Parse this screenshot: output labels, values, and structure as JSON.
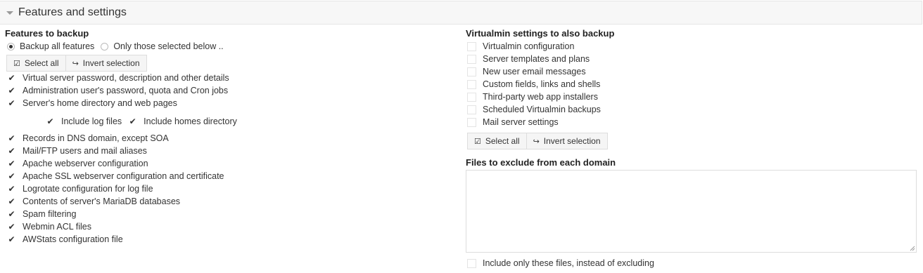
{
  "header": {
    "title": "Features and settings"
  },
  "features": {
    "title": "Features to backup",
    "radio_all": "Backup all features",
    "radio_selected": "Only those selected below ..",
    "select_all": "Select all",
    "invert_selection": "Invert selection",
    "items_top": [
      "Virtual server password, description and other details",
      "Administration user's password, quota and Cron jobs",
      "Server's home directory and web pages"
    ],
    "include_log": "Include log files",
    "include_homes": "Include homes directory",
    "items_bottom": [
      "Records in DNS domain, except SOA",
      "Mail/FTP users and mail aliases",
      "Apache webserver configuration",
      "Apache SSL webserver configuration and certificate",
      "Logrotate configuration for log file",
      "Contents of server's MariaDB databases",
      "Spam filtering",
      "Webmin ACL files",
      "AWStats configuration file"
    ]
  },
  "settings": {
    "title": "Virtualmin settings to also backup",
    "items": [
      "Virtualmin configuration",
      "Server templates and plans",
      "New user email messages",
      "Custom fields, links and shells",
      "Third-party web app installers",
      "Scheduled Virtualmin backups",
      "Mail server settings"
    ],
    "select_all": "Select all",
    "invert_selection": "Invert selection"
  },
  "exclude": {
    "title": "Files to exclude from each domain",
    "value": "",
    "include_only": "Include only these files, instead of excluding"
  }
}
